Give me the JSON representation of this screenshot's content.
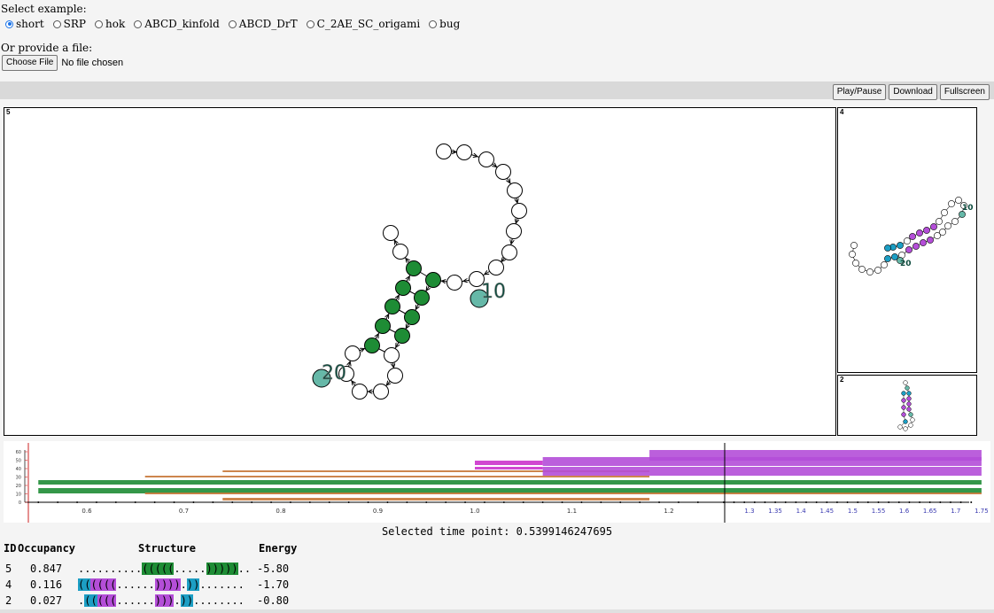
{
  "controls": {
    "select_label": "Select example:",
    "examples": [
      {
        "label": "short",
        "selected": true
      },
      {
        "label": "SRP",
        "selected": false
      },
      {
        "label": "hok",
        "selected": false
      },
      {
        "label": "ABCD_kinfold",
        "selected": false
      },
      {
        "label": "ABCD_DrT",
        "selected": false
      },
      {
        "label": "C_2AE_SC_origami",
        "selected": false
      },
      {
        "label": "bug",
        "selected": false
      }
    ],
    "file_label": "Or provide a file:",
    "file_button": "Choose File",
    "file_status": "No file chosen"
  },
  "toolbar": {
    "play_pause": "Play/Pause",
    "download": "Download",
    "fullscreen": "Fullscreen"
  },
  "panels": {
    "main": {
      "id": "5",
      "label_10": "10",
      "label_20": "20"
    },
    "side_top": {
      "id": "4",
      "label_10": "10",
      "label_20": "20"
    },
    "side_bottom": {
      "id": "2"
    }
  },
  "colors": {
    "green": "#1e8c35",
    "teal": "#66b8a8",
    "purple": "#b44ed8",
    "blue": "#1c9ec4",
    "orange": "#c8783a",
    "red": "#cc2222"
  },
  "timeline": {
    "x_ticks_left": [
      "0.6",
      "0.7",
      "0.8",
      "0.9",
      "1.0",
      "1.1",
      "1.2"
    ],
    "x_ticks_right": [
      "1.3",
      "1.35",
      "1.4",
      "1.45",
      "1.5",
      "1.55",
      "1.6",
      "1.65",
      "1.7",
      "1.75"
    ],
    "y_ticks": [
      "60",
      "50",
      "40",
      "30",
      "20",
      "10",
      "0"
    ]
  },
  "selected_time": "Selected time point: 0.5399146247695",
  "table": {
    "headers": {
      "id": "ID",
      "occupancy": "Occupancy",
      "structure": "Structure",
      "energy": "Energy"
    },
    "rows": [
      {
        "id": "5",
        "occupancy": "0.847",
        "energy": "-5.80",
        "segments": [
          {
            "text": "..........",
            "color": ""
          },
          {
            "text": "(((((",
            "color": "green"
          },
          {
            "text": ".....",
            "color": ""
          },
          {
            "text": ")))))",
            "color": "green"
          },
          {
            "text": "..",
            "color": ""
          }
        ]
      },
      {
        "id": "4",
        "occupancy": "0.116",
        "energy": "-1.70",
        "segments": [
          {
            "text": "((",
            "color": "blue"
          },
          {
            "text": "((((",
            "color": "purple"
          },
          {
            "text": "......",
            "color": ""
          },
          {
            "text": "))))",
            "color": "purple"
          },
          {
            "text": ".",
            "color": ""
          },
          {
            "text": "))",
            "color": "blue"
          },
          {
            "text": ".......",
            "color": ""
          }
        ]
      },
      {
        "id": "2",
        "occupancy": "0.027",
        "energy": "-0.80",
        "segments": [
          {
            "text": ".",
            "color": ""
          },
          {
            "text": "((",
            "color": "blue"
          },
          {
            "text": "(((",
            "color": "purple"
          },
          {
            "text": "......",
            "color": ""
          },
          {
            "text": ")))",
            "color": "purple"
          },
          {
            "text": ".",
            "color": ""
          },
          {
            "text": "))",
            "color": "blue"
          },
          {
            "text": "........",
            "color": ""
          }
        ]
      }
    ]
  }
}
